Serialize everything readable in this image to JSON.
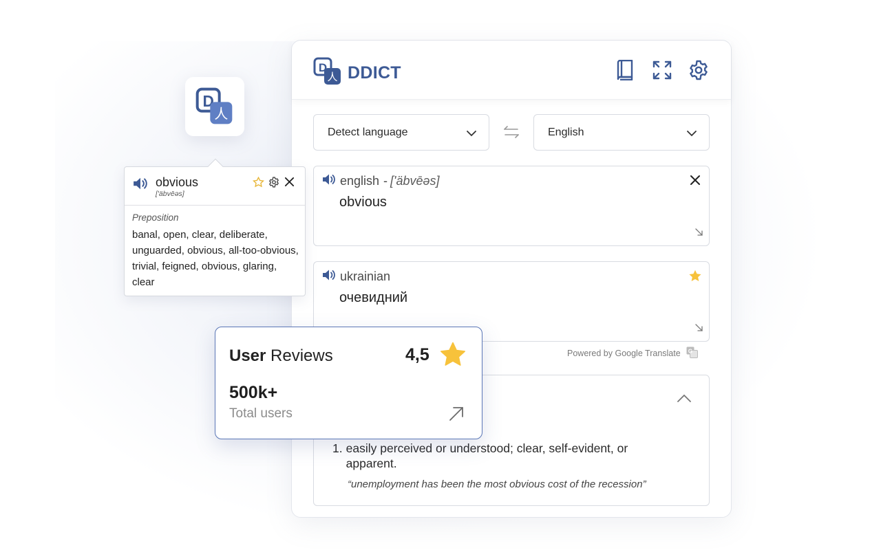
{
  "app": {
    "brand_name": "DDICT",
    "logo_letters": "D",
    "logo_glyph": "人",
    "accent_color": "#3d5a95",
    "star_color": "#f7c23b"
  },
  "header": {
    "icons": [
      "book-icon",
      "expand-icon",
      "gear-icon"
    ]
  },
  "language_selector": {
    "source": "Detect language",
    "target": "English"
  },
  "source_box": {
    "language": "english",
    "separator": "-",
    "phonetic": "['äbvēəs]",
    "text": "obvious"
  },
  "target_box": {
    "language": "ukrainian",
    "text": "очевидний"
  },
  "powered_by": "Powered by Google Translate",
  "definition": {
    "number": "1.",
    "text": "easily perceived or understood; clear, self-evident, or apparent.",
    "example": "“unemployment has been the most obvious cost of the recession”"
  },
  "popup": {
    "word": "obvious",
    "phonetic": "['äbvēəs]",
    "part_of_speech": "Preposition",
    "synonyms": "banal, open, clear, deliberate, unguarded, obvious, all-too-obvious, trivial, feigned, obvious, glaring, clear"
  },
  "reviews": {
    "title_bold": "User",
    "title_light": " Reviews",
    "score": "4,5",
    "count": "500k+",
    "count_label": "Total users"
  }
}
